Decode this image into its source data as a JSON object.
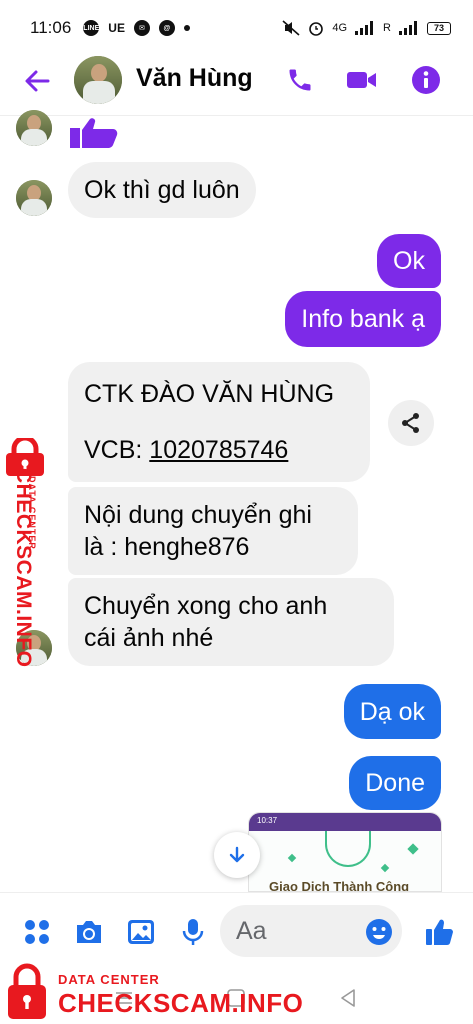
{
  "status_bar": {
    "time": "11:06",
    "carrier_icons": [
      "LINE",
      "UE",
      "messenger-icon",
      "threads-icon"
    ],
    "network": "4G",
    "roaming": "R",
    "battery": "73"
  },
  "header": {
    "contact_name": "Văn Hùng",
    "accent_color": "#7d2ae8",
    "icons": [
      "back-arrow-icon",
      "phone-icon",
      "video-camera-icon",
      "info-icon"
    ]
  },
  "messages": [
    {
      "id": "m1",
      "direction": "incoming",
      "type": "sticker",
      "icon": "thumbs-up-icon"
    },
    {
      "id": "m2",
      "direction": "incoming",
      "text": "Ok thì gd luôn"
    },
    {
      "id": "m3",
      "direction": "outgoing",
      "text": "Ok"
    },
    {
      "id": "m4",
      "direction": "outgoing",
      "text": "Info bank ạ"
    },
    {
      "id": "m5",
      "direction": "incoming",
      "line1": "CTK ĐÀO VĂN HÙNG",
      "line2_prefix": "VCB: ",
      "line2_account": "1020785746"
    },
    {
      "id": "m6",
      "direction": "incoming",
      "line1": "Nội dung chuyển ghi",
      "line2": "là : henghe876"
    },
    {
      "id": "m7",
      "direction": "incoming",
      "line1": "Chuyển xong cho anh",
      "line2": "cái ảnh nhé"
    },
    {
      "id": "m8",
      "direction": "outgoing",
      "text": "Dạ ok"
    },
    {
      "id": "m9",
      "direction": "outgoing",
      "text": "Done"
    },
    {
      "id": "m10",
      "direction": "outgoing",
      "type": "image",
      "preview_time": "10:37",
      "preview_title": "Giao Dịch Thành Công"
    }
  ],
  "composer": {
    "placeholder": "Aa",
    "icons": [
      "apps-grid-icon",
      "camera-icon",
      "gallery-icon",
      "microphone-icon",
      "emoji-icon",
      "like-icon"
    ]
  },
  "watermark": {
    "small_text": "DATA CENTER",
    "big_text": "CHECKSCAM.INFO",
    "color": "#e8191f"
  },
  "colors": {
    "outgoing_bubble": "#7d2ae8",
    "outgoing_bubble_latest": "#1f6fe8",
    "incoming_bubble": "#f0f0f0"
  }
}
